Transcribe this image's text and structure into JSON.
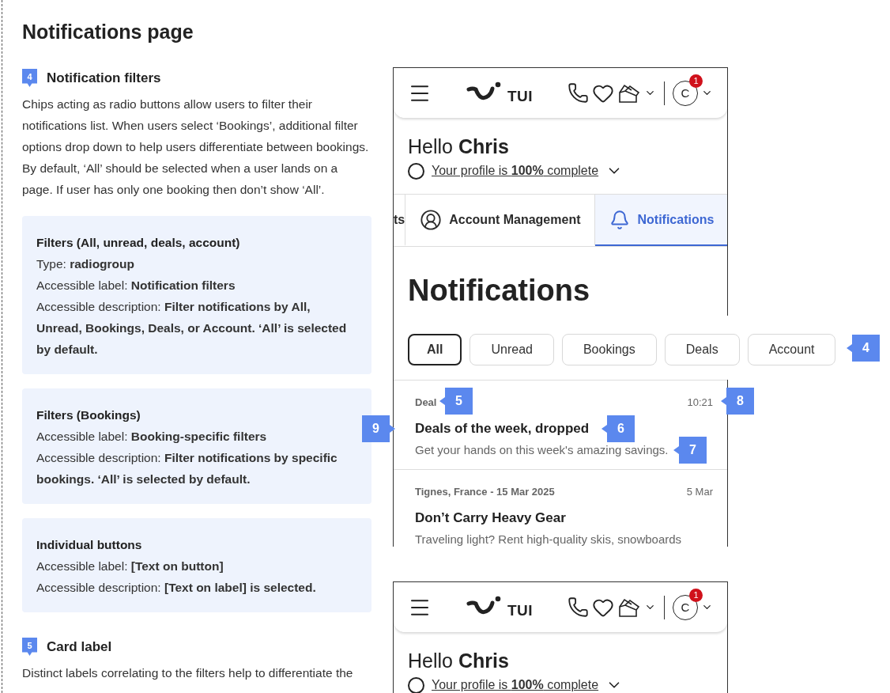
{
  "page_title": "Notifications page",
  "sections": [
    {
      "marker": "4",
      "title": "Notification filters",
      "paragraph": "Chips acting as radio buttons allow users to filter their notifications list. When users select ‘Bookings’, additional filter options drop down to help users differentiate between bookings. By default, ‘All’ should be selected when a user lands on a page. If user has only one booking then don’t show ‘All’.",
      "info_boxes": [
        {
          "title": "Filters (All, unread, deals, account)",
          "lines": [
            "Type: **radiogroup**",
            "Accessible label: **Notification filters**",
            "Accessible description: **Filter notifications by All, Unread, Bookings, Deals, or Account. ‘All’ is selected by default.**"
          ]
        },
        {
          "title": "Filters (Bookings)",
          "lines": [
            "Accessible label: **Booking-specific filters**",
            "Accessible description: **Filter notifications by specific bookings. ‘All’ is selected by default.**"
          ]
        },
        {
          "title": "Individual buttons",
          "lines": [
            "Accessible label: **[Text on button]**",
            "Accessible description: **[Text on label] is selected.**"
          ]
        }
      ]
    },
    {
      "marker": "5",
      "title": "Card label",
      "paragraph": "Distinct labels correlating to the filters help to differentiate the"
    }
  ],
  "mockups": [
    {
      "header": {
        "logo_text": "TUI",
        "notification_count": "1",
        "avatar_initial": "C"
      },
      "greeting": "Hello **Chris**",
      "profile_link": "Your profile is **100%** complete",
      "tabs": [
        {
          "label": "ts",
          "selected": false
        },
        {
          "label": "Account Management",
          "selected": false
        },
        {
          "label": "Notifications",
          "selected": true
        }
      ],
      "heading": "Notifications",
      "filters": [
        {
          "label": "All",
          "selected": true
        },
        {
          "label": "Unread",
          "selected": false
        },
        {
          "label": "Bookings",
          "selected": false
        },
        {
          "label": "Deals",
          "selected": false
        },
        {
          "label": "Account",
          "selected": false
        }
      ],
      "notifications": [
        {
          "label": "Deal",
          "time": "10:21",
          "title": "Deals of the week, dropped",
          "body": "Get your hands on this week's amazing savings."
        },
        {
          "label": "Tignes, France - 15 Mar 2025",
          "time": "5 Mar",
          "title": "Don’t Carry Heavy Gear",
          "body": "Traveling light? Rent high-quality skis, snowboards"
        }
      ]
    },
    {
      "header": {
        "logo_text": "TUI",
        "notification_count": "1",
        "avatar_initial": "C"
      },
      "greeting": "Hello **Chris**",
      "profile_link": "Your profile is **100%** complete"
    }
  ],
  "annotations": [
    {
      "number": "4"
    },
    {
      "number": "5"
    },
    {
      "number": "8"
    },
    {
      "number": "9"
    },
    {
      "number": "6"
    },
    {
      "number": "7"
    }
  ]
}
